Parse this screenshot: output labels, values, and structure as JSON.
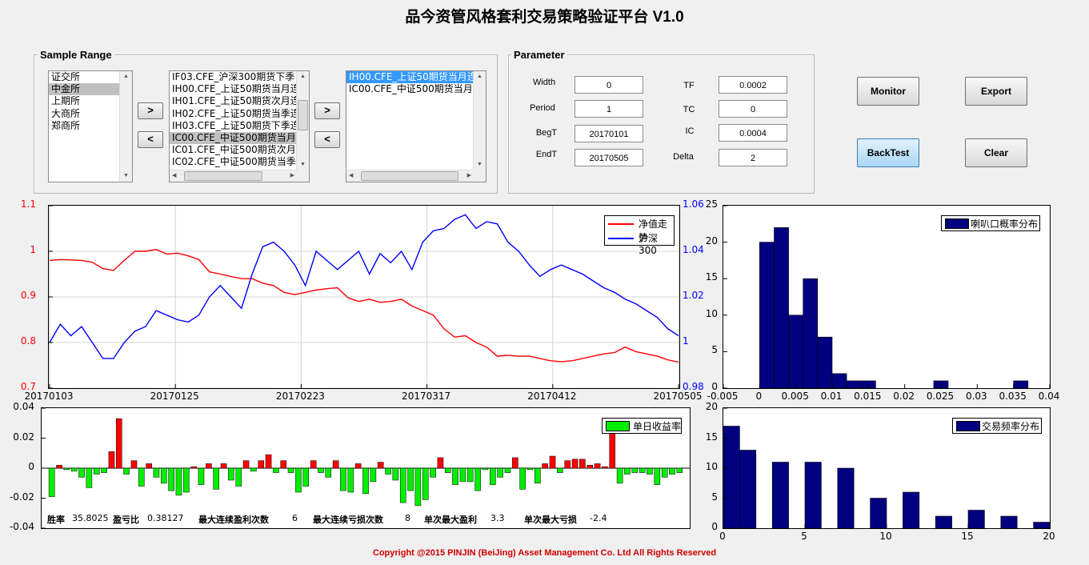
{
  "app": {
    "title": "品今资管风格套利交易策略验证平台 V1.0"
  },
  "sample_range": {
    "label": "Sample Range",
    "exchanges": [
      "证交所",
      "中金所",
      "上期所",
      "大商所",
      "郑商所"
    ],
    "exchange_selected": "中金所",
    "contracts": [
      "IF03.CFE_沪深300期货下季",
      "IH00.CFE_上证50期货当月连",
      "IH01.CFE_上证50期货次月连",
      "IH02.CFE_上证50期货当季连",
      "IH03.CFE_上证50期货下季连",
      "IC00.CFE_中证500期货当月",
      "IC01.CFE_中证500期货次月",
      "IC02.CFE_中证500期货当季"
    ],
    "contract_selected": "IC00.CFE_中证500期货当月",
    "selected_contracts": [
      "IH00.CFE_上证50期货当月连",
      "IC00.CFE_中证500期货当月"
    ],
    "add_label": ">",
    "remove_label": "<"
  },
  "parameter": {
    "label": "Parameter",
    "width_label": "Width",
    "width_value": "0",
    "period_label": "Period",
    "period_value": "1",
    "begt_label": "BegT",
    "begt_value": "20170101",
    "endt_label": "EndT",
    "endt_value": "20170505",
    "tf_label": "TF",
    "tf_value": "0.0002",
    "tc_label": "TC",
    "tc_value": "0",
    "ic_label": "IC",
    "ic_value": "0.0004",
    "delta_label": "Delta",
    "delta_value": "2"
  },
  "buttons": {
    "monitor": "Monitor",
    "export": "Export",
    "backtest": "BackTest",
    "clear": "Clear"
  },
  "colors": {
    "red": "#ff0000",
    "blue": "#0000ff",
    "green": "#00ee00",
    "navy": "#000080",
    "copyright": "#d00000"
  },
  "chart_data": [
    {
      "type": "line",
      "x_ticks": [
        "20170103",
        "20170125",
        "20170223",
        "20170317",
        "20170412",
        "20170505"
      ],
      "ylim_left": [
        0.7,
        1.1
      ],
      "y_ticks_left": [
        "0.7",
        "0.8",
        "0.9",
        "1",
        "1.1"
      ],
      "ylim_right": [
        0.98,
        1.06
      ],
      "y_ticks_right": [
        "0.98",
        "1",
        "1.02",
        "1.04",
        "1.06"
      ],
      "grid": true,
      "legend": "top-right",
      "series": [
        {
          "name": "净值走势",
          "color": "#ff0000",
          "axis": "left",
          "values": [
            0.98,
            0.982,
            0.981,
            0.98,
            0.976,
            0.962,
            0.958,
            0.98,
            1.0,
            1.0,
            1.004,
            0.994,
            0.996,
            0.99,
            0.982,
            0.955,
            0.95,
            0.945,
            0.94,
            0.94,
            0.93,
            0.925,
            0.91,
            0.905,
            0.91,
            0.915,
            0.918,
            0.92,
            0.898,
            0.89,
            0.895,
            0.888,
            0.89,
            0.895,
            0.88,
            0.87,
            0.86,
            0.83,
            0.812,
            0.815,
            0.8,
            0.79,
            0.77,
            0.772,
            0.77,
            0.77,
            0.765,
            0.76,
            0.758,
            0.76,
            0.765,
            0.77,
            0.775,
            0.778,
            0.79,
            0.78,
            0.775,
            0.77,
            0.762,
            0.757
          ]
        },
        {
          "name": "沪深300",
          "color": "#0000ff",
          "axis": "right",
          "values": [
            1.0,
            1.008,
            1.003,
            1.007,
            1.0,
            0.993,
            0.993,
            1.0,
            1.005,
            1.007,
            1.014,
            1.012,
            1.01,
            1.009,
            1.012,
            1.02,
            1.025,
            1.02,
            1.015,
            1.03,
            1.042,
            1.044,
            1.04,
            1.034,
            1.025,
            1.04,
            1.036,
            1.032,
            1.036,
            1.04,
            1.03,
            1.039,
            1.035,
            1.04,
            1.032,
            1.044,
            1.049,
            1.05,
            1.054,
            1.056,
            1.05,
            1.053,
            1.052,
            1.044,
            1.04,
            1.034,
            1.029,
            1.032,
            1.034,
            1.032,
            1.03,
            1.027,
            1.024,
            1.022,
            1.019,
            1.017,
            1.014,
            1.011,
            1.006,
            1.003
          ]
        }
      ]
    },
    {
      "type": "bar",
      "ylim": [
        -0.04,
        0.04
      ],
      "y_ticks": [
        "-0.04",
        "-0.02",
        "0",
        "0.02",
        "0.04"
      ],
      "legend": "top-right",
      "series": [
        {
          "name": "单日收益率",
          "values": [
            -0.019,
            0.002,
            -0.001,
            -0.002,
            -0.006,
            -0.013,
            -0.004,
            -0.003,
            0.011,
            0.033,
            -0.004,
            0.005,
            -0.012,
            0.003,
            -0.006,
            -0.01,
            -0.015,
            -0.018,
            -0.016,
            0.001,
            -0.011,
            0.003,
            -0.014,
            0.003,
            -0.008,
            -0.012,
            0.005,
            -0.002,
            0.005,
            0.009,
            -0.003,
            0.005,
            -0.003,
            -0.016,
            -0.012,
            0.005,
            -0.003,
            -0.006,
            0.005,
            -0.015,
            -0.016,
            0.003,
            -0.017,
            -0.009,
            0.004,
            -0.004,
            -0.008,
            -0.023,
            -0.015,
            -0.025,
            -0.021,
            -0.006,
            0.007,
            -0.003,
            -0.011,
            -0.009,
            -0.009,
            -0.015,
            -0.001,
            -0.011,
            -0.006,
            -0.003,
            0.007,
            -0.014,
            -0.001,
            -0.01,
            0.003,
            0.008,
            -0.003,
            0.005,
            0.006,
            0.006,
            0.002,
            0.003,
            0.001,
            0.025,
            -0.01,
            -0.004,
            -0.003,
            -0.003,
            -0.004,
            -0.011,
            -0.006,
            -0.004,
            -0.003
          ]
        }
      ]
    },
    {
      "type": "bar",
      "title": "",
      "xlim": [
        -0.005,
        0.04
      ],
      "x_ticks": [
        "-0.005",
        "0",
        "0.005",
        "0.01",
        "0.015",
        "0.02",
        "0.025",
        "0.03",
        "0.035",
        "0.04"
      ],
      "ylim": [
        0,
        25
      ],
      "y_ticks": [
        "0",
        "5",
        "10",
        "15",
        "20",
        "25"
      ],
      "bin_width": 0.002,
      "bin_starts": [
        0.0,
        0.002,
        0.004,
        0.006,
        0.008,
        0.01,
        0.012,
        0.014,
        0.024,
        0.035
      ],
      "values": [
        20,
        22,
        10,
        15,
        7,
        2,
        1,
        1,
        1,
        1
      ],
      "legend": "top-right",
      "series_name": "喇叭口概率分布"
    },
    {
      "type": "bar",
      "xlim": [
        0,
        20
      ],
      "x_ticks": [
        "0",
        "5",
        "10",
        "15",
        "20"
      ],
      "ylim": [
        0,
        20
      ],
      "y_ticks": [
        "0",
        "5",
        "10",
        "15",
        "20"
      ],
      "bin_width": 1,
      "bin_starts": [
        0,
        1,
        3,
        5,
        7,
        9,
        11,
        13,
        15,
        17,
        19
      ],
      "values": [
        17,
        13,
        11,
        11,
        10,
        5,
        6,
        2,
        3,
        2,
        1
      ],
      "legend": "top-right",
      "series_name": "交易频率分布"
    }
  ],
  "stats": {
    "win_rate_label": "胜率",
    "win_rate": "35.8025",
    "pl_ratio_label": "盈亏比",
    "pl_ratio": "0.38127",
    "max_win_streak_label": "最大连续盈利次数",
    "max_win_streak": "6",
    "max_loss_streak_label": "最大连续亏损次数",
    "max_loss_streak": "8",
    "max_single_profit_label": "单次最大盈利",
    "max_single_profit": "3.3",
    "max_single_loss_label": "单次最大亏损",
    "max_single_loss": "-2.4"
  },
  "footer": {
    "copyright": "Copyright @2015 PINJIN (BeiJing) Asset Management Co. Ltd      All Rights Reserved"
  }
}
